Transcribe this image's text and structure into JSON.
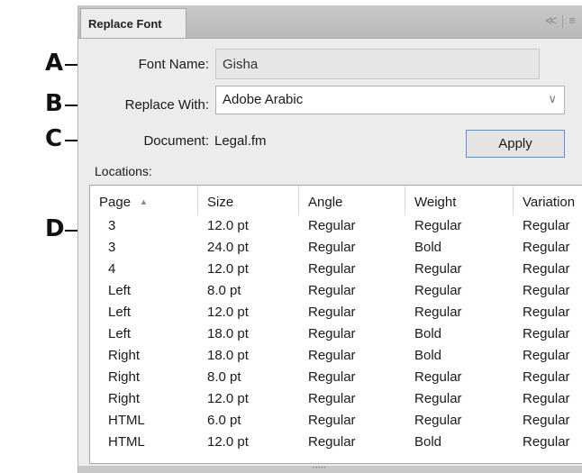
{
  "callouts": {
    "a": "A",
    "b": "B",
    "c": "C",
    "d": "D"
  },
  "panel": {
    "tab_title": "Replace Font",
    "collapse_icon": "double-chevron-icon",
    "menu_icon": "hamburger-menu-icon"
  },
  "font_name": {
    "label": "Font Name:",
    "value": "Gisha"
  },
  "replace_with": {
    "label": "Replace With:",
    "value": "Adobe Arabic"
  },
  "document": {
    "label": "Document:",
    "value": "Legal.fm"
  },
  "apply_label": "Apply",
  "locations": {
    "label": "Locations:",
    "columns": [
      "Page",
      "Size",
      "Angle",
      "Weight",
      "Variation"
    ],
    "sort_indicator": "▲",
    "rows": [
      [
        "3",
        "12.0 pt",
        "Regular",
        "Regular",
        "Regular"
      ],
      [
        "3",
        "24.0 pt",
        "Regular",
        "Bold",
        "Regular"
      ],
      [
        "4",
        "12.0 pt",
        "Regular",
        "Regular",
        "Regular"
      ],
      [
        "Left",
        "8.0 pt",
        "Regular",
        "Regular",
        "Regular"
      ],
      [
        "Left",
        "12.0 pt",
        "Regular",
        "Regular",
        "Regular"
      ],
      [
        "Left",
        "18.0 pt",
        "Regular",
        "Bold",
        "Regular"
      ],
      [
        "Right",
        "18.0 pt",
        "Regular",
        "Bold",
        "Regular"
      ],
      [
        "Right",
        "8.0 pt",
        "Regular",
        "Regular",
        "Regular"
      ],
      [
        "Right",
        "12.0 pt",
        "Regular",
        "Regular",
        "Regular"
      ],
      [
        "HTML",
        "6.0 pt",
        "Regular",
        "Regular",
        "Regular"
      ],
      [
        "HTML",
        "12.0 pt",
        "Regular",
        "Bold",
        "Regular"
      ]
    ]
  }
}
